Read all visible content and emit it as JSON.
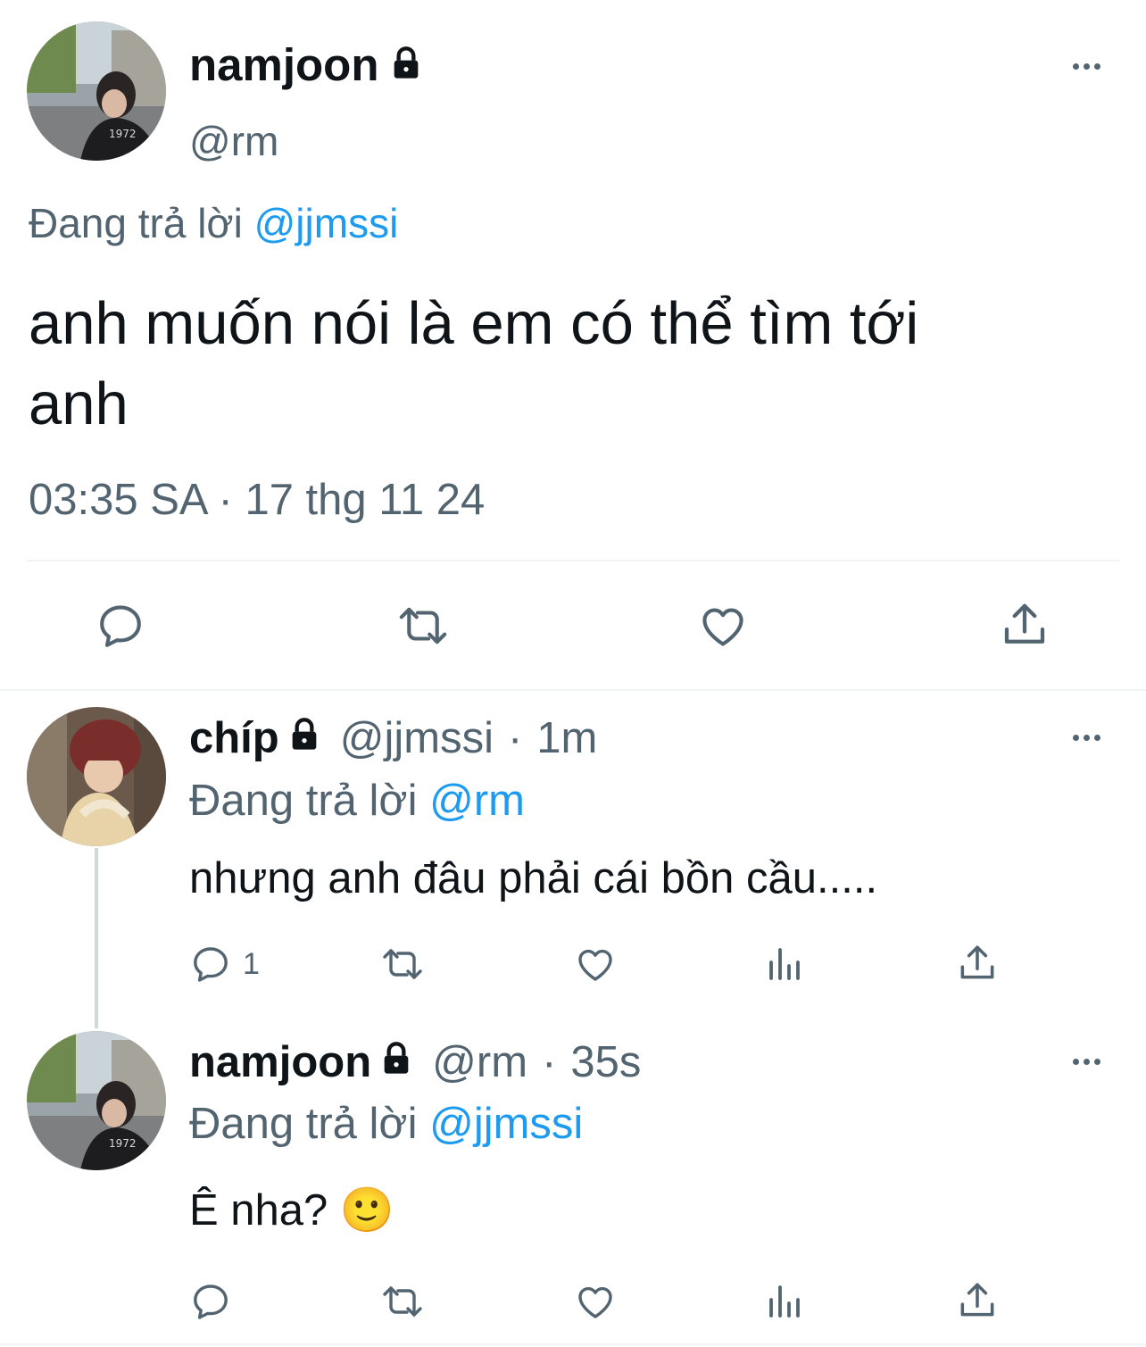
{
  "main_tweet": {
    "display_name": "namjoon",
    "handle": "@rm",
    "reply_prefix": "Đang trả lời",
    "reply_to": "@jjmssi",
    "text_line1": "anh muốn nói là em có thể tìm tới",
    "text_line2": "anh",
    "timestamp": "03:35 SA · 17 thg 11 24"
  },
  "replies": [
    {
      "display_name": "chíp",
      "handle": "@jjmssi",
      "separator": "·",
      "time": "1m",
      "reply_prefix": "Đang trả lời",
      "reply_to": "@rm",
      "text": "nhưng anh đâu phải cái bồn cầu.....",
      "reply_count": "1"
    },
    {
      "display_name": "namjoon",
      "handle": "@rm",
      "separator": "·",
      "time": "35s",
      "reply_prefix": "Đang trả lời",
      "reply_to": "@jjmssi",
      "text": "Ê nha? 🙂"
    }
  ],
  "icons": [
    "lock-icon",
    "more-icon",
    "reply-icon",
    "retweet-icon",
    "like-icon",
    "analytics-icon",
    "share-icon"
  ],
  "colors": {
    "link": "#1d9bf0",
    "muted": "#536471",
    "text": "#0f1419",
    "rule": "#eff3f4"
  }
}
